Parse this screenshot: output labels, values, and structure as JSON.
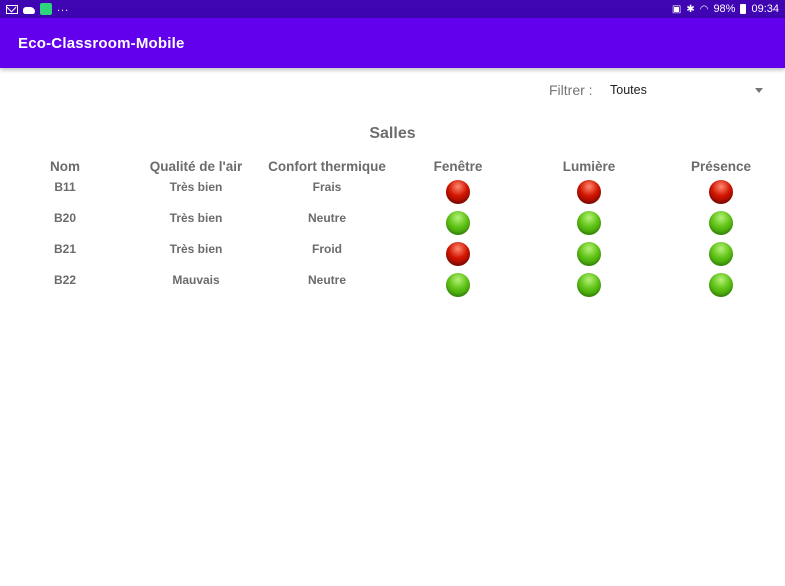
{
  "status_bar": {
    "more_indicator": "...",
    "battery_percent": "98%",
    "time": "09:34",
    "icons": [
      "mail-icon",
      "cloud-icon",
      "app-notification-icon",
      "nfc-icon",
      "bluetooth-icon",
      "wifi-icon",
      "battery-icon"
    ]
  },
  "app_bar": {
    "title": "Eco-Classroom-Mobile",
    "color": "#6200ee"
  },
  "filter": {
    "label": "Filtrer :",
    "selected": "Toutes"
  },
  "section_title": "Salles",
  "table": {
    "headers": [
      "Nom",
      "Qualité de l'air",
      "Confort thermique",
      "Fenêtre",
      "Lumière",
      "Présence"
    ],
    "rows": [
      {
        "nom": "B11",
        "air": "Très bien",
        "confort": "Frais",
        "fenetre": "red",
        "lumiere": "red",
        "presence": "red"
      },
      {
        "nom": "B20",
        "air": "Très bien",
        "confort": "Neutre",
        "fenetre": "green",
        "lumiere": "green",
        "presence": "green"
      },
      {
        "nom": "B21",
        "air": "Très bien",
        "confort": "Froid",
        "fenetre": "red",
        "lumiere": "green",
        "presence": "green"
      },
      {
        "nom": "B22",
        "air": "Mauvais",
        "confort": "Neutre",
        "fenetre": "green",
        "lumiere": "green",
        "presence": "green"
      }
    ]
  },
  "status_colors": {
    "green": "#5fc215",
    "red": "#d11400"
  }
}
